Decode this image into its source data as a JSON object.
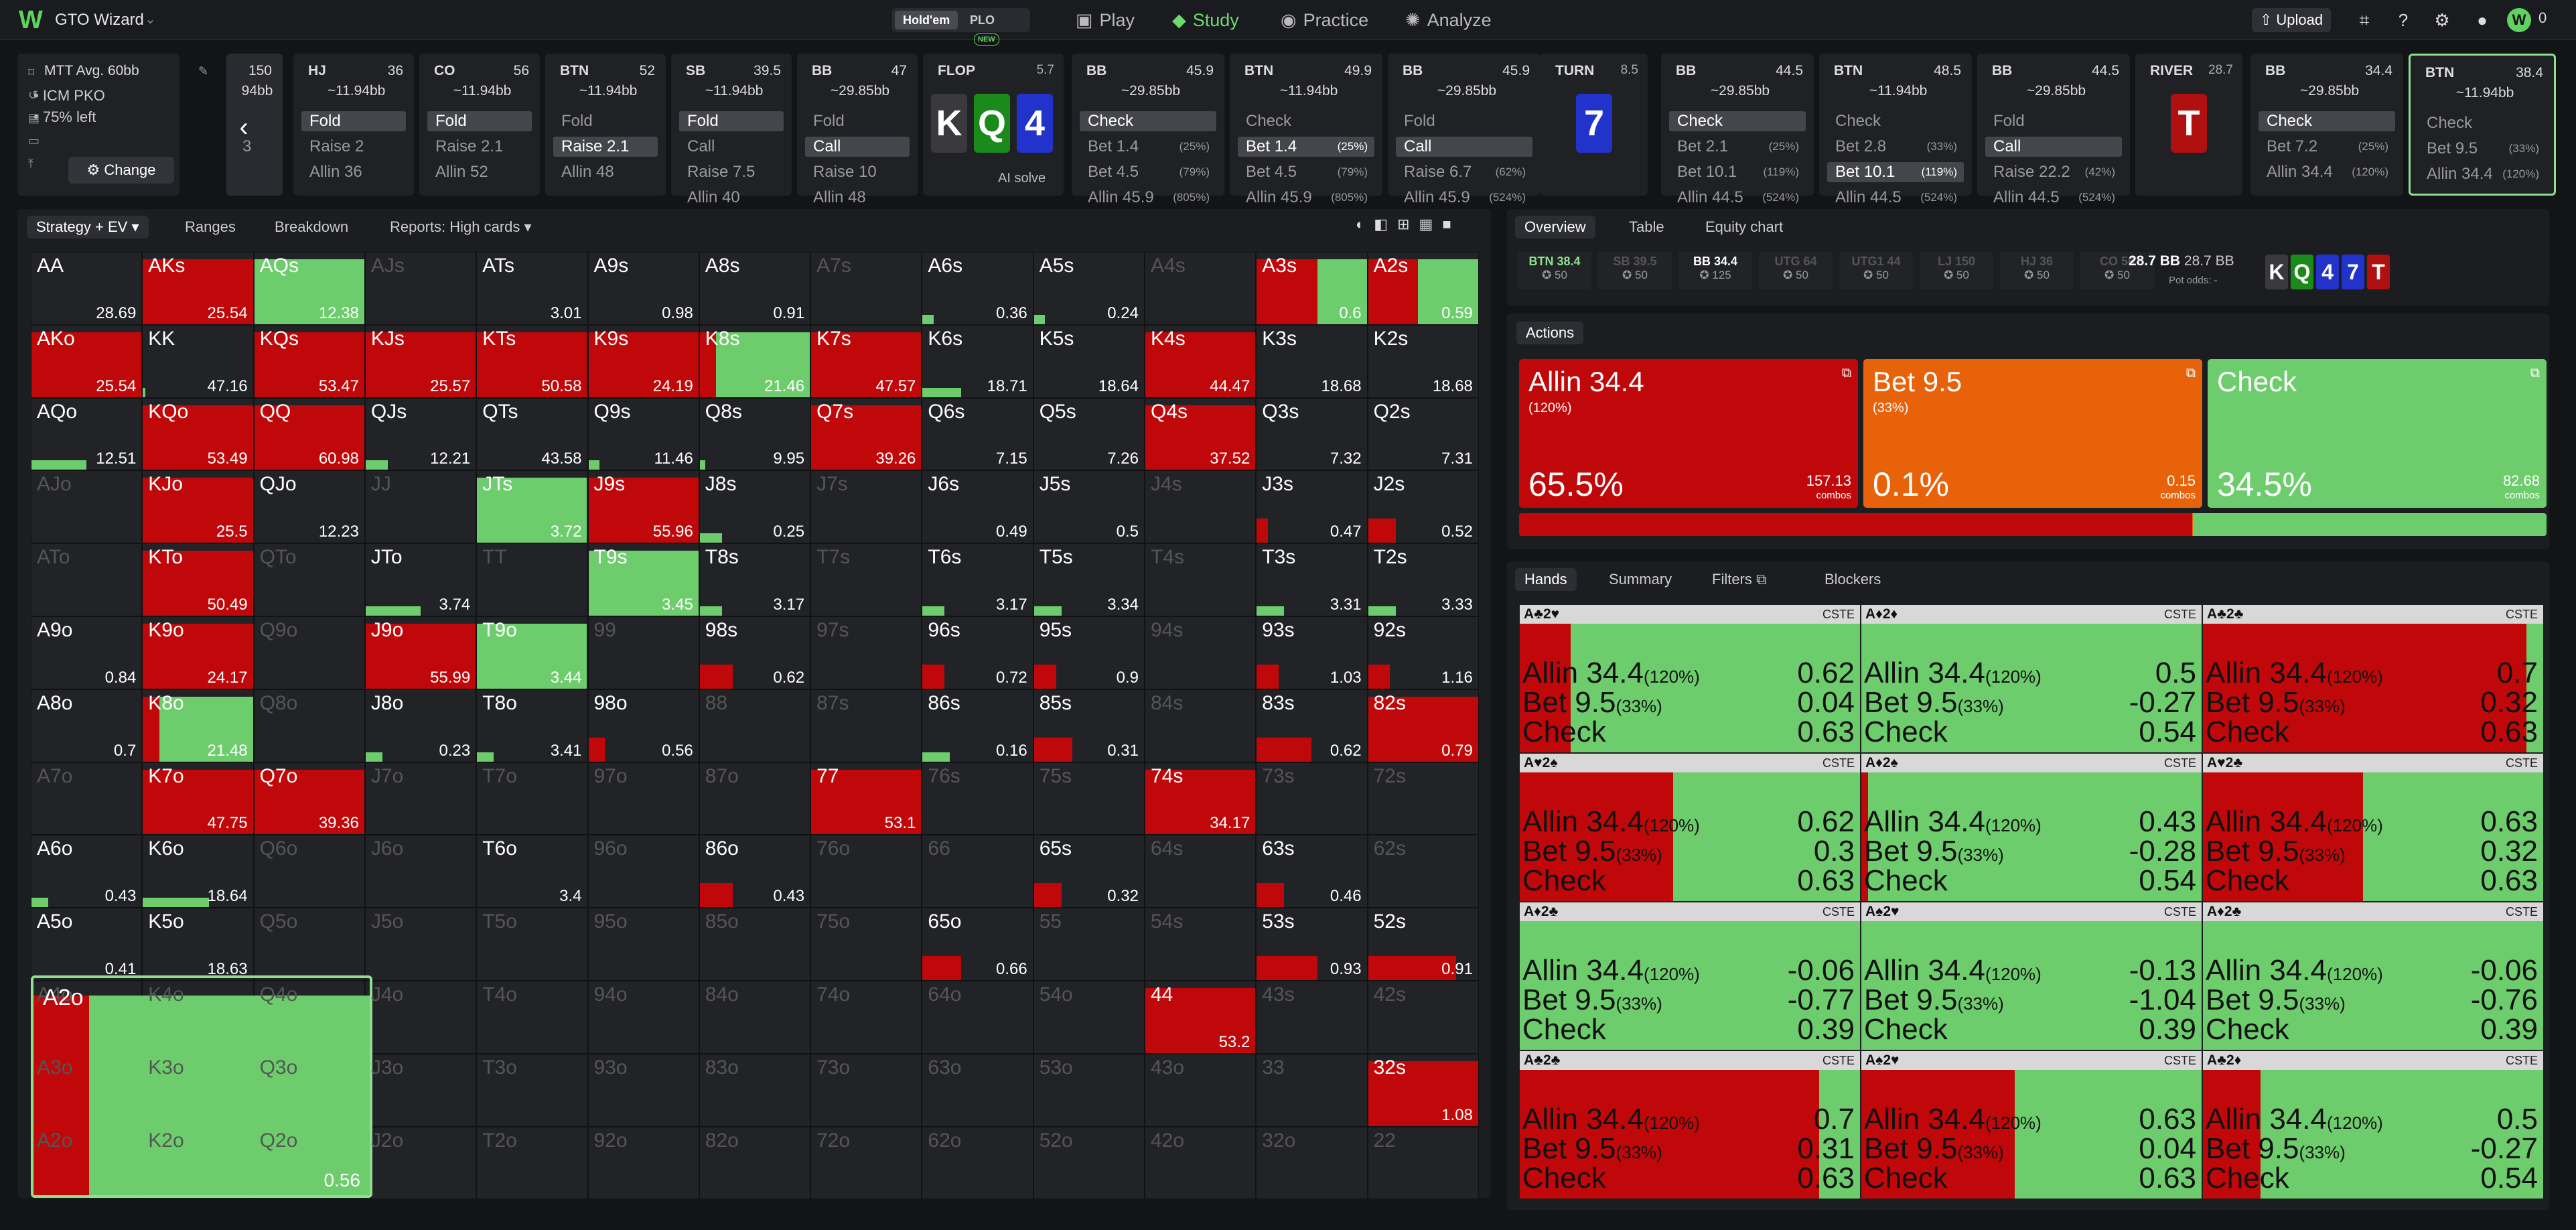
{
  "app": {
    "name": "GTO Wizard",
    "game_tabs": [
      "Hold'em",
      "PLO"
    ],
    "plo_badge": "NEW",
    "nav": [
      "Play",
      "Study",
      "Practice",
      "Analyze"
    ],
    "upload": "Upload",
    "coins": "0",
    "avatar_letter": "W"
  },
  "spot": {
    "title": "MTT Avg. 60bb",
    "format": "ICM PKO",
    "left": "75% left",
    "change": "Change"
  },
  "action_cards": [
    {
      "pos": "",
      "stack": "150",
      "bb": "94bb",
      "opts": [
        {
          "t": ""
        },
        {
          "t": "3"
        }
      ]
    },
    {
      "pos": "HJ",
      "stack": "36",
      "bb": "~11.94bb",
      "opts": [
        {
          "t": "Fold",
          "sel": true
        },
        {
          "t": "Raise 2"
        },
        {
          "t": "Allin 36"
        }
      ]
    },
    {
      "pos": "CO",
      "stack": "56",
      "bb": "~11.94bb",
      "opts": [
        {
          "t": "Fold",
          "sel": true
        },
        {
          "t": "Raise 2.1"
        },
        {
          "t": "Allin 52"
        }
      ]
    },
    {
      "pos": "BTN",
      "stack": "52",
      "bb": "~11.94bb",
      "opts": [
        {
          "t": "Fold"
        },
        {
          "t": "Raise 2.1",
          "sel": true
        },
        {
          "t": "Allin 48"
        }
      ]
    },
    {
      "pos": "SB",
      "stack": "39.5",
      "bb": "~11.94bb",
      "opts": [
        {
          "t": "Fold",
          "sel": true
        },
        {
          "t": "Call"
        },
        {
          "t": "Raise 7.5"
        },
        {
          "t": "Allin 40"
        }
      ]
    },
    {
      "pos": "BB",
      "stack": "47",
      "bb": "~29.85bb",
      "opts": [
        {
          "t": "Fold"
        },
        {
          "t": "Call",
          "sel": true
        },
        {
          "t": "Raise 10"
        },
        {
          "t": "Allin 48"
        }
      ]
    },
    {
      "pos": "BB",
      "stack": "45.9",
      "bb": "~29.85bb",
      "opts": [
        {
          "t": "Check",
          "sel": true
        },
        {
          "t": "Bet 1.4",
          "p": "(25%)"
        },
        {
          "t": "Bet 4.5",
          "p": "(79%)"
        },
        {
          "t": "Allin 45.9",
          "p": "(805%)"
        }
      ]
    },
    {
      "pos": "BTN",
      "stack": "49.9",
      "bb": "~11.94bb",
      "opts": [
        {
          "t": "Check"
        },
        {
          "t": "Bet 1.4",
          "p": "(25%)",
          "sel": true
        },
        {
          "t": "Bet 4.5",
          "p": "(79%)"
        },
        {
          "t": "Allin 45.9",
          "p": "(805%)"
        }
      ]
    },
    {
      "pos": "BB",
      "stack": "45.9",
      "bb": "~29.85bb",
      "opts": [
        {
          "t": "Fold"
        },
        {
          "t": "Call",
          "sel": true
        },
        {
          "t": "Raise 6.7",
          "p": "(62%)"
        },
        {
          "t": "Allin 45.9",
          "p": "(524%)"
        }
      ]
    },
    {
      "pos": "BB",
      "stack": "44.5",
      "bb": "~29.85bb",
      "opts": [
        {
          "t": "Check",
          "sel": true
        },
        {
          "t": "Bet 2.1",
          "p": "(25%)"
        },
        {
          "t": "Bet 10.1",
          "p": "(119%)"
        },
        {
          "t": "Allin 44.5",
          "p": "(524%)"
        }
      ]
    },
    {
      "pos": "BTN",
      "stack": "48.5",
      "bb": "~11.94bb",
      "opts": [
        {
          "t": "Check"
        },
        {
          "t": "Bet 2.8",
          "p": "(33%)"
        },
        {
          "t": "Bet 10.1",
          "p": "(119%)",
          "sel": true
        },
        {
          "t": "Allin 44.5",
          "p": "(524%)"
        }
      ]
    },
    {
      "pos": "BB",
      "stack": "44.5",
      "bb": "~29.85bb",
      "opts": [
        {
          "t": "Fold"
        },
        {
          "t": "Call",
          "sel": true
        },
        {
          "t": "Raise 22.2",
          "p": "(42%)"
        },
        {
          "t": "Allin 44.5",
          "p": "(524%)"
        }
      ]
    },
    {
      "pos": "BB",
      "stack": "34.4",
      "bb": "~29.85bb",
      "opts": [
        {
          "t": "Check",
          "sel": true
        },
        {
          "t": "Bet 7.2",
          "p": "(25%)"
        },
        {
          "t": "Allin 34.4",
          "p": "(120%)"
        }
      ]
    },
    {
      "pos": "BTN",
      "stack": "38.4",
      "bb": "~11.94bb",
      "opts": [
        {
          "t": "Check"
        },
        {
          "t": "Bet 9.5",
          "p": "(33%)"
        },
        {
          "t": "Allin 34.4",
          "p": "(120%)"
        }
      ]
    }
  ],
  "streets": [
    {
      "name": "FLOP",
      "pot": "5.7",
      "cards": [
        "K",
        "Q",
        "4"
      ],
      "ai": "AI solve"
    },
    {
      "name": "TURN",
      "pot": "8.5",
      "cards": [
        "7"
      ]
    },
    {
      "name": "RIVER",
      "pot": "28.7",
      "cards": [
        "T"
      ]
    }
  ],
  "left_tabs": [
    "Strategy + EV",
    "Ranges",
    "Breakdown",
    "Reports: High cards"
  ],
  "grid_rows": [
    [
      "AA|28.69|0|0",
      "AKs|25.54|1|0",
      "AQs|12.38|0|1",
      "AJs||",
      "ATs|3.01|0|0",
      "A9s|0.98|0|0",
      "A8s|0.91|0|0",
      "A7s||",
      "A6s|0.36|0|0.1",
      "A5s|0.24|0|0.1",
      "A4s||",
      "A3s|0.6|0.55|0.45",
      "A2s|0.59|0.45|0.55"
    ],
    [
      "AKo|25.54|1|0",
      "KK|47.16|0|0.02",
      "KQs|53.47|1|0",
      "KJs|25.57|1|0",
      "KTs|50.58|1|0",
      "K9s|24.19|1|0",
      "K8s|21.46|0.15|0.85",
      "K7s|47.57|1|0",
      "K6s|18.71|0|0.35",
      "K5s|18.64|0|0",
      "K4s|44.47|1|0",
      "K3s|18.68|0|0",
      "K2s|18.68|0|0"
    ],
    [
      "AQo|12.51|0|0.5",
      "KQo|53.49|1|0",
      "QQ|60.98|1|0",
      "QJs|12.21|0|0.2",
      "QTs|43.58|0|0",
      "Q9s|11.46|0|0.1",
      "Q8s|9.95|0|0.05",
      "Q7s|39.26|1|0",
      "Q6s|7.15|0|0",
      "Q5s|7.26|0|0",
      "Q4s|37.52|1|0",
      "Q3s|7.32|0|0",
      "Q2s|7.31|0|0"
    ],
    [
      "AJo||",
      "KJo|25.5|1|0",
      "QJo|12.23|0|0",
      "JJ||",
      "JTs|3.72|0|1",
      "J9s|55.96|1|0",
      "J8s|0.25|0|0.2",
      "J7s||",
      "J6s|0.49|0|0",
      "J5s|0.5|0|0",
      "J4s||",
      "J3s|0.47|0.1|0",
      "J2s|0.52|0.25|0"
    ],
    [
      "ATo||",
      "KTo|50.49|1|0",
      "QTo||",
      "JTo|3.74|0|0.5",
      "TT||",
      "T9s|3.45|0|1",
      "T8s|3.17|0|0.2",
      "T7s||",
      "T6s|3.17|0|0.2",
      "T5s|3.34|0|0.25",
      "T4s||",
      "T3s|3.31|0|0.25",
      "T2s|3.33|0|0.25"
    ],
    [
      "A9o|0.84|0|0",
      "K9o|24.17|1|0",
      "Q9o||",
      "J9o|55.99|1|0",
      "T9o|3.44|0|1",
      "99||",
      "98s|0.62|0.3|0",
      "97s||",
      "96s|0.72|0.2|0",
      "95s|0.9|0.2|0",
      "94s||",
      "93s|1.03|0.2|0",
      "92s|1.16|0.2|0"
    ],
    [
      "A8o|0.7|0|0",
      "K8o|21.48|0.15|0.85",
      "Q8o||",
      "J8o|0.23|0|0.15",
      "T8o|3.41|0|0.15",
      "98o|0.56|0.15|0",
      "88||",
      "87s||",
      "86s|0.16|0|0.25",
      "85s|0.31|0.35|0",
      "84s||",
      "83s|0.62|0.5|0",
      "82s|0.79|1|0"
    ],
    [
      "A7o||",
      "K7o|47.75|1|0",
      "Q7o|39.36|1|0",
      "J7o||",
      "T7o||",
      "97o||",
      "87o||",
      "77|53.1|1|0",
      "76s||",
      "75s||",
      "74s|34.17|1|0",
      "73s||",
      "72s||"
    ],
    [
      "A6o|0.43|0|0.15",
      "K6o|18.64|0|0.6",
      "Q6o||",
      "J6o||",
      "T6o|3.4|0|0",
      "96o||",
      "86o|0.43|0.3|0",
      "76o||",
      "66||",
      "65s|0.32|0.25|0",
      "64s||",
      "63s|0.46|0.25|0",
      "62s||"
    ],
    [
      "A5o|0.41|0|0",
      "K5o|18.63|0|0",
      "Q5o||",
      "J5o||",
      "T5o||",
      "95o||",
      "85o||",
      "75o||",
      "65o|0.66|0.35|0",
      "55||",
      "54s||",
      "53s|0.93|0.55|0",
      "52s|0.91|0.8|0"
    ],
    [
      "A4o||",
      "K4o||",
      "Q4o||",
      "J4o||",
      "T4o||",
      "94o||",
      "84o||",
      "74o||",
      "64o||",
      "54o||",
      "44|53.2|1|0",
      "43s||",
      "42s||"
    ],
    [
      "A3o||",
      "K3o||",
      "Q3o||",
      "J3o||",
      "T3o||",
      "93o||",
      "83o||",
      "73o||",
      "63o||",
      "53o||",
      "43o||",
      "33||",
      "32s|1.08|1|0"
    ],
    [
      "A2o||",
      "K2o||",
      "Q2o||",
      "J2o||",
      "T2o||",
      "92o||",
      "82o||",
      "72o||",
      "62o||",
      "52o||",
      "42o||",
      "32o||",
      "22||"
    ]
  ],
  "selected_hand": {
    "name": "A2o",
    "ev": "0.56",
    "allin": 0.5
  },
  "right_tabs": [
    "Overview",
    "Table",
    "Equity chart"
  ],
  "players": [
    {
      "pos": "BTN",
      "stk": "38.4",
      "b": "50",
      "c": "#8ee08e"
    },
    {
      "pos": "SB",
      "stk": "39.5",
      "b": "50",
      "c": "#555"
    },
    {
      "pos": "BB",
      "stk": "34.4",
      "b": "125",
      "c": "#fff"
    },
    {
      "pos": "UTG",
      "stk": "64",
      "b": "50",
      "c": "#555"
    },
    {
      "pos": "UTG1",
      "stk": "44",
      "b": "50",
      "c": "#555"
    },
    {
      "pos": "LJ",
      "stk": "150",
      "b": "50",
      "c": "#555"
    },
    {
      "pos": "HJ",
      "stk": "36",
      "b": "50",
      "c": "#555"
    },
    {
      "pos": "CO",
      "stk": "56",
      "b": "50",
      "c": "#555"
    }
  ],
  "pot": {
    "a": "28.7 BB",
    "b": "28.7 BB",
    "odds": "Pot odds: -"
  },
  "board": [
    "K",
    "Q",
    "4",
    "7",
    "T"
  ],
  "actions_label": "Actions",
  "actions": [
    {
      "name": "Allin 34.4",
      "pct": "(120%)",
      "freq": "65.5%",
      "combos": "157.13",
      "combos_label": "combos",
      "color": "#c0080a"
    },
    {
      "name": "Bet 9.5",
      "pct": "(33%)",
      "freq": "0.1%",
      "combos": "0.15",
      "combos_label": "combos",
      "color": "#e8620a"
    },
    {
      "name": "Check",
      "pct": "",
      "freq": "34.5%",
      "combos": "82.68",
      "combos_label": "combos",
      "color": "#6dcd6d"
    }
  ],
  "dist": {
    "allin": 0.655,
    "bet": 0.001,
    "check": 0.344
  },
  "hand_tabs": [
    "Hands",
    "Summary",
    "Filters",
    "Blockers"
  ],
  "hands": [
    {
      "cards": "A♣2♥",
      "tag": "CSTE",
      "allin": "0.62",
      "bet": "0.04",
      "check": "0.63",
      "red": 0.15
    },
    {
      "cards": "A♦2♦",
      "tag": "CSTE",
      "allin": "0.5",
      "bet": "-0.27",
      "check": "0.54",
      "red": 0
    },
    {
      "cards": "A♣2♣",
      "tag": "CSTE",
      "allin": "0.7",
      "bet": "0.32",
      "check": "0.63",
      "red": 0.95
    },
    {
      "cards": "A♥2♠",
      "tag": "CSTE",
      "allin": "0.62",
      "bet": "0.3",
      "check": "0.63",
      "red": 0.45
    },
    {
      "cards": "A♦2♠",
      "tag": "CSTE",
      "allin": "0.43",
      "bet": "-0.28",
      "check": "0.54",
      "red": 0.02
    },
    {
      "cards": "A♥2♣",
      "tag": "CSTE",
      "allin": "0.63",
      "bet": "0.32",
      "check": "0.63",
      "red": 0.47
    },
    {
      "cards": "A♦2♣",
      "tag": "CSTE",
      "allin": "-0.06",
      "bet": "-0.77",
      "check": "0.39",
      "red": 0
    },
    {
      "cards": "A♠2♥",
      "tag": "CSTE",
      "allin": "-0.13",
      "bet": "-1.04",
      "check": "0.39",
      "red": 0
    },
    {
      "cards": "A♦2♣",
      "tag": "CSTE",
      "allin": "-0.06",
      "bet": "-0.76",
      "check": "0.39",
      "red": 0
    },
    {
      "cards": "A♣2♣",
      "tag": "CSTE",
      "allin": "0.7",
      "bet": "0.31",
      "check": "0.63",
      "red": 0.88
    },
    {
      "cards": "A♠2♥",
      "tag": "CSTE",
      "allin": "0.63",
      "bet": "0.04",
      "check": "0.63",
      "red": 0.45
    },
    {
      "cards": "A♣2♦",
      "tag": "CSTE",
      "allin": "0.5",
      "bet": "-0.27",
      "check": "0.54",
      "red": 0.17
    }
  ],
  "row_labels": {
    "allin": "Allin 34.4",
    "allin_p": "(120%)",
    "bet": "Bet 9.5",
    "bet_p": "(33%)",
    "check": "Check"
  },
  "colors": {
    "allin": "#c0080a",
    "bet": "#e8620a",
    "check": "#6dcd6d",
    "accent": "#5fd35f"
  }
}
